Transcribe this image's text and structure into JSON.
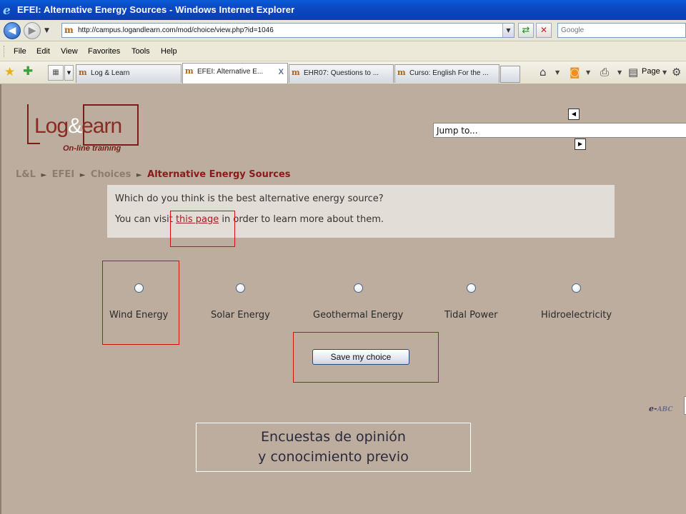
{
  "window": {
    "title": "EFEI: Alternative Energy Sources - Windows Internet Explorer"
  },
  "address_bar": {
    "url": "http://campus.logandlearn.com/mod/choice/view.php?id=1046",
    "search_placeholder": "Google"
  },
  "menu": [
    "File",
    "Edit",
    "View",
    "Favorites",
    "Tools",
    "Help"
  ],
  "tabs": [
    {
      "label": "Log & Learn",
      "active": false
    },
    {
      "label": "EFEI: Alternative E...",
      "active": true
    },
    {
      "label": "EHR07: Questions to ...",
      "active": false
    },
    {
      "label": "Curso: English For the ...",
      "active": false
    }
  ],
  "tab_close": "X",
  "commandbar": {
    "page_label": "Page"
  },
  "logo": {
    "text_left": "Log",
    "amp": "&",
    "text_right": "earn",
    "tagline": "On-line training"
  },
  "jump": {
    "label": "Jump to..."
  },
  "breadcrumb": {
    "items": [
      "L&L",
      "EFEI",
      "Choices"
    ],
    "current": "Alternative Energy Sources",
    "separator": "►"
  },
  "intro": {
    "question": "Which do you think is the best alternative energy source?",
    "visit_prefix": "You can visit ",
    "visit_link": "this page",
    "visit_suffix": " in order to learn more about them."
  },
  "choices": [
    {
      "label": "Wind Energy"
    },
    {
      "label": "Solar Energy"
    },
    {
      "label": "Geothermal Energy"
    },
    {
      "label": "Tidal Power"
    },
    {
      "label": "Hidroelectricity"
    }
  ],
  "save_button": "Save my choice",
  "eabc": {
    "e": "e-",
    "abc": "ABC"
  },
  "caption": {
    "line1": "Encuestas de opinión",
    "line2": "y conocimiento previo"
  },
  "colors": {
    "highlight": "#d01010",
    "breadcrumb_current": "#8b1a1a",
    "page_bg": "#bcad9e"
  }
}
